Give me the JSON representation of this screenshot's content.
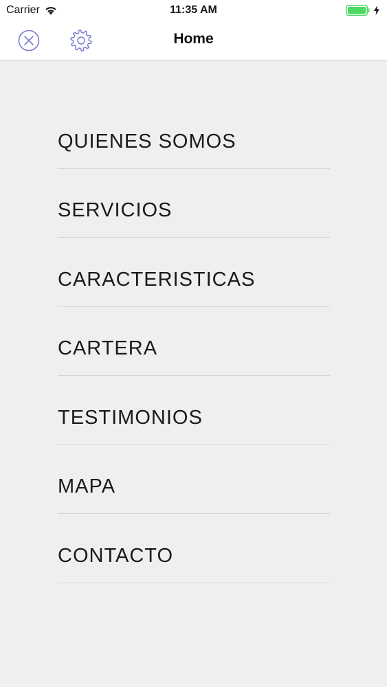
{
  "status_bar": {
    "carrier": "Carrier",
    "time": "11:35 AM",
    "battery_color": "#4cd964"
  },
  "nav": {
    "title": "Home",
    "close_icon": "close-circle-icon",
    "settings_icon": "gear-icon",
    "icon_color": "#6e72c8"
  },
  "menu": {
    "items": [
      {
        "label": "QUIENES SOMOS"
      },
      {
        "label": "SERVICIOS"
      },
      {
        "label": "CARACTERISTICAS"
      },
      {
        "label": "CARTERA"
      },
      {
        "label": "TESTIMONIOS"
      },
      {
        "label": "MAPA"
      },
      {
        "label": "CONTACTO"
      }
    ]
  }
}
